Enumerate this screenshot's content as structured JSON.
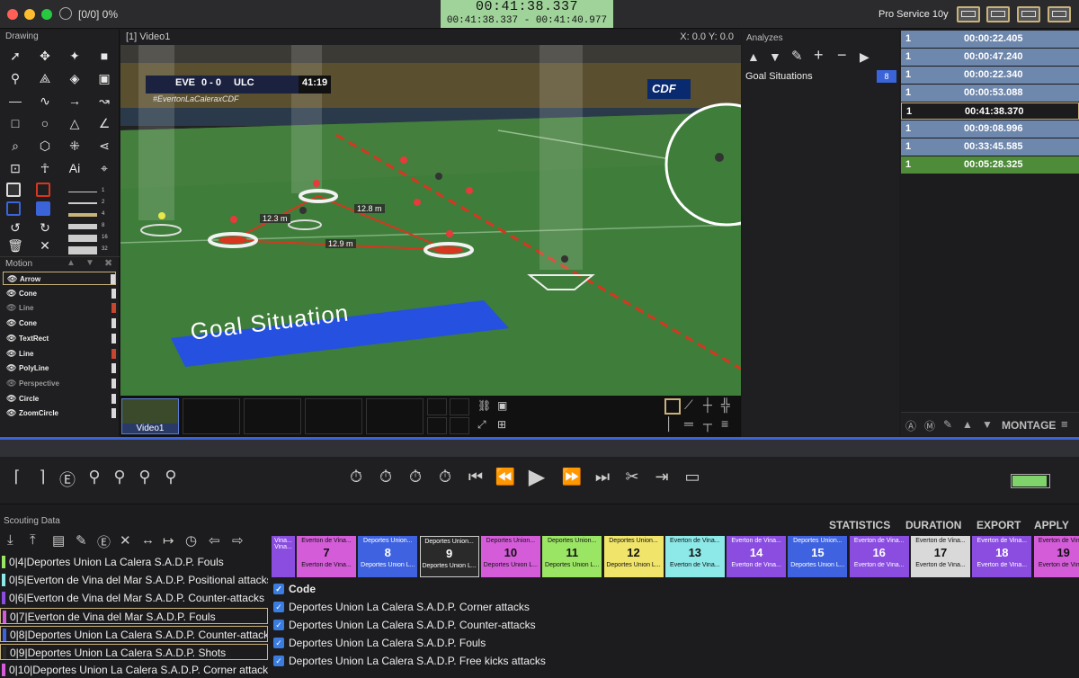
{
  "titlebar": {
    "status": "[0/0] 0%",
    "timecode": "00:41:38.337",
    "timecode_range": "00:41:38.337  -  00:41:40.977",
    "product": "Pro Service 10y"
  },
  "drawing_panel": {
    "title": "Drawing",
    "line_widths": [
      "1",
      "2",
      "4",
      "8",
      "16",
      "32"
    ]
  },
  "motion_panel": {
    "title": "Motion",
    "items": [
      {
        "label": "Arrow",
        "color": "#d9d9d9",
        "visible": true
      },
      {
        "label": "Cone",
        "color": "#d9d9d9",
        "visible": true
      },
      {
        "label": "Line",
        "color": "#c8452e",
        "visible": false
      },
      {
        "label": "Cone",
        "color": "#d9d9d9",
        "visible": true
      },
      {
        "label": "TextRect",
        "color": "#d9d9d9",
        "visible": true
      },
      {
        "label": "Line",
        "color": "#c8452e",
        "visible": true
      },
      {
        "label": "PolyLine",
        "color": "#d9d9d9",
        "visible": true
      },
      {
        "label": "Perspective",
        "color": "#d9d9d9",
        "visible": false
      },
      {
        "label": "Circle",
        "color": "#d9d9d9",
        "visible": true
      },
      {
        "label": "ZoomCircle",
        "color": "#d9d9d9",
        "visible": true
      }
    ]
  },
  "video": {
    "title": "[1] Video1",
    "coords": "X: 0.0  Y: 0.0",
    "scoreboard": {
      "home": "EVE",
      "score": "0 - 0",
      "away": "ULC",
      "clock": "41:19"
    },
    "hashtag": "#EvertonLaCaleraxCDF",
    "broadcaster": "CDF",
    "distances": [
      "12.3 m",
      "12.8 m",
      "12.9 m"
    ],
    "banner_text": "Goal Situation",
    "thumbnail_label": "Video1"
  },
  "analyzes": {
    "title": "Analyzes",
    "items": [
      {
        "label": "Goal Situations",
        "count": "8"
      }
    ],
    "montage_label": "MONTAGE"
  },
  "timelist": [
    {
      "n": "1",
      "time": "00:00:22.405",
      "color": "#6e87ad"
    },
    {
      "n": "1",
      "time": "00:00:47.240",
      "color": "#6e87ad"
    },
    {
      "n": "1",
      "time": "00:00:22.340",
      "color": "#6e87ad"
    },
    {
      "n": "1",
      "time": "00:00:53.088",
      "color": "#6e87ad"
    },
    {
      "n": "1",
      "time": "00:41:38.370",
      "color": "#1c1c1e"
    },
    {
      "n": "1",
      "time": "00:09:08.996",
      "color": "#6e87ad"
    },
    {
      "n": "1",
      "time": "00:33:45.585",
      "color": "#6e87ad"
    },
    {
      "n": "1",
      "time": "00:05:28.325",
      "color": "#4e8c3a"
    }
  ],
  "scouting": {
    "title": "Scouting Data",
    "rows": [
      {
        "text": "0|4|Deportes Union La Calera S.A.D.P. Fouls",
        "color": "#9be564"
      },
      {
        "text": "0|5|Everton de Vina del Mar S.A.D.P. Positional attacks w",
        "color": "#8de8e8"
      },
      {
        "text": "0|6|Everton de Vina del Mar S.A.D.P. Counter-attacks",
        "color": "#8a4de0"
      },
      {
        "text": "0|7|Everton de Vina del Mar S.A.D.P. Fouls",
        "color": "#d45cd9"
      },
      {
        "text": "0|8|Deportes Union La Calera S.A.D.P. Counter-attacks",
        "color": "#3f63e0"
      },
      {
        "text": "0|9|Deportes Union La Calera S.A.D.P. Shots",
        "color": "#2a2a2a"
      },
      {
        "text": "0|10|Deportes Union La Calera S.A.D.P. Corner attacks",
        "color": "#d45cd9"
      }
    ]
  },
  "code_panel": {
    "buttons": [
      "STATISTICS",
      "DURATION",
      "EXPORT",
      "APPLY"
    ],
    "cards": [
      {
        "top": "Vina...",
        "num": "",
        "bot": "Vina...",
        "color": "#8a4de0"
      },
      {
        "top": "Everton de Vina...",
        "num": "7",
        "bot": "Everton de Vina...",
        "color": "#d45cd9"
      },
      {
        "top": "Deportes Union...",
        "num": "8",
        "bot": "Deportes Union L...",
        "color": "#3f63e0"
      },
      {
        "top": "Deportes Union...",
        "num": "9",
        "bot": "Deportes Union L...",
        "color": "#2a2a2a"
      },
      {
        "top": "Deportes Union...",
        "num": "10",
        "bot": "Deportes Union L...",
        "color": "#d45cd9"
      },
      {
        "top": "Deportes Union...",
        "num": "11",
        "bot": "Deportes Union L...",
        "color": "#9be564"
      },
      {
        "top": "Deportes Union...",
        "num": "12",
        "bot": "Deportes Union L...",
        "color": "#f0e46a"
      },
      {
        "top": "Everton de Vina...",
        "num": "13",
        "bot": "Everton de Vina...",
        "color": "#8de8e8"
      },
      {
        "top": "Everton de Vina...",
        "num": "14",
        "bot": "Everton de Vina...",
        "color": "#8a4de0"
      },
      {
        "top": "Deportes Union...",
        "num": "15",
        "bot": "Deportes Union L...",
        "color": "#3f63e0"
      },
      {
        "top": "Everton de Vina...",
        "num": "16",
        "bot": "Everton de Vina...",
        "color": "#8a4de0"
      },
      {
        "top": "Everton de Vina...",
        "num": "17",
        "bot": "Everton de Vina...",
        "color": "#d9d9d9"
      },
      {
        "top": "Everton de Vina...",
        "num": "18",
        "bot": "Everton de Vina...",
        "color": "#8a4de0"
      },
      {
        "top": "Everton de Vina...",
        "num": "19",
        "bot": "Everton de Vina...",
        "color": "#d45cd9"
      }
    ],
    "checkbox_header": "Code",
    "checkbox_items": [
      "Deportes Union La Calera S.A.D.P. Corner attacks",
      "Deportes Union La Calera S.A.D.P. Counter-attacks",
      "Deportes Union La Calera S.A.D.P. Fouls",
      "Deportes Union La Calera S.A.D.P. Free kicks attacks"
    ]
  }
}
